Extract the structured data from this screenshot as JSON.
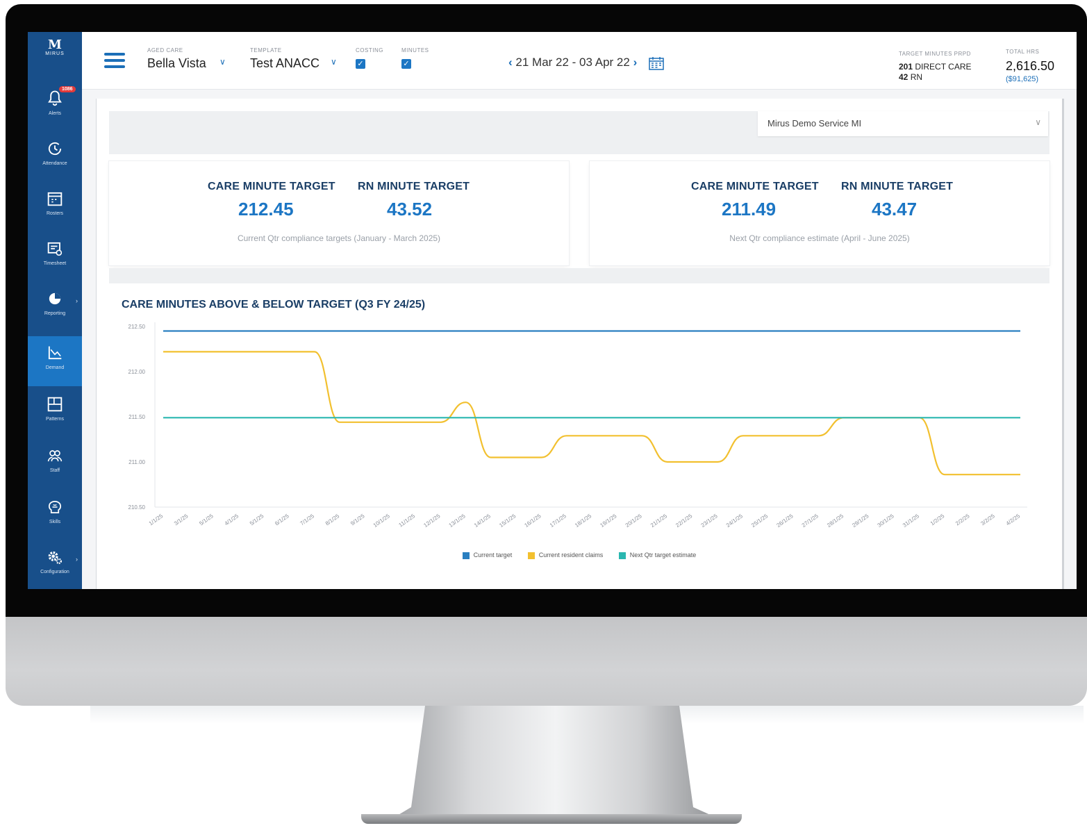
{
  "app": {
    "logo_text": "MIRUS",
    "alerts_badge": "1086"
  },
  "nav": [
    {
      "label": "Alerts",
      "icon": "bell-icon"
    },
    {
      "label": "Attendance",
      "icon": "clock-icon"
    },
    {
      "label": "Rosters",
      "icon": "calendar-grid-icon"
    },
    {
      "label": "Timesheet",
      "icon": "timesheet-icon"
    },
    {
      "label": "Reporting",
      "icon": "pie-chart-icon"
    },
    {
      "label": "Demand",
      "icon": "line-chart-icon",
      "active": true
    },
    {
      "label": "Patterns",
      "icon": "layout-icon"
    },
    {
      "label": "Staff",
      "icon": "staff-icon"
    },
    {
      "label": "Skills",
      "icon": "brain-icon"
    },
    {
      "label": "Configuration",
      "icon": "gear-icon"
    }
  ],
  "header": {
    "aged_care_caption": "AGED CARE",
    "aged_care_value": "Bella Vista",
    "template_caption": "TEMPLATE",
    "template_value": "Test ANACC",
    "costing_caption": "COSTING",
    "minutes_caption": "MINUTES",
    "costing_checked": true,
    "minutes_checked": true,
    "date_range": "21 Mar 22 - 03 Apr 22",
    "target_caption": "TARGET MINUTES PRPD",
    "target_direct_value": "201",
    "target_direct_label": "DIRECT CARE",
    "target_rn_value": "42",
    "target_rn_label": "RN",
    "total_hrs_caption": "TOTAL HRS",
    "total_hrs_value": "2,616.50",
    "total_cost": "($91,625)"
  },
  "service_select": {
    "value": "Mirus Demo Service MI"
  },
  "cards": [
    {
      "care_heading": "CARE MINUTE TARGET",
      "care_value": "212.45",
      "rn_heading": "RN MINUTE TARGET",
      "rn_value": "43.52",
      "note": "Current Qtr compliance targets (January - March 2025)"
    },
    {
      "care_heading": "CARE MINUTE TARGET",
      "care_value": "211.49",
      "rn_heading": "RN MINUTE TARGET",
      "rn_value": "43.47",
      "note": "Next Qtr compliance estimate (April - June 2025)"
    }
  ],
  "chart_title": "CARE MINUTES ABOVE & BELOW TARGET (Q3 FY 24/25)",
  "chart_data": {
    "type": "line",
    "title": "CARE MINUTES ABOVE & BELOW TARGET (Q3 FY 24/25)",
    "xlabel": "",
    "ylabel": "",
    "ylim": [
      210.5,
      212.5
    ],
    "y_ticks": [
      "210.50",
      "211.00",
      "211.50",
      "212.00",
      "212.50"
    ],
    "categories": [
      "1/1/25",
      "3/1/25",
      "5/1/25",
      "4/1/25",
      "5/1/25",
      "6/1/25",
      "7/1/25",
      "8/1/25",
      "9/1/25",
      "10/1/25",
      "11/1/25",
      "12/1/25",
      "13/1/25",
      "14/1/25",
      "15/1/25",
      "16/1/25",
      "17/1/25",
      "18/1/25",
      "19/1/25",
      "20/1/25",
      "21/1/25",
      "22/1/25",
      "23/1/25",
      "24/1/25",
      "25/1/25",
      "26/1/25",
      "27/1/25",
      "28/1/25",
      "29/1/25",
      "30/1/25",
      "31/1/25",
      "1/2/25",
      "2/2/25",
      "3/2/25",
      "4/2/25"
    ],
    "grid": false,
    "legend_position": "bottom-center",
    "series": [
      {
        "name": "Current target",
        "color": "#2a7fc0",
        "values": [
          212.45,
          212.45,
          212.45,
          212.45,
          212.45,
          212.45,
          212.45,
          212.45,
          212.45,
          212.45,
          212.45,
          212.45,
          212.45,
          212.45,
          212.45,
          212.45,
          212.45,
          212.45,
          212.45,
          212.45,
          212.45,
          212.45,
          212.45,
          212.45,
          212.45,
          212.45,
          212.45,
          212.45,
          212.45,
          212.45,
          212.45,
          212.45,
          212.45,
          212.45,
          212.45
        ]
      },
      {
        "name": "Current resident claims",
        "color": "#f2c02f",
        "values": [
          212.22,
          212.22,
          212.22,
          212.22,
          212.22,
          212.22,
          212.22,
          211.44,
          211.44,
          211.44,
          211.44,
          211.44,
          211.66,
          211.05,
          211.05,
          211.05,
          211.29,
          211.29,
          211.29,
          211.29,
          211.0,
          211.0,
          211.0,
          211.29,
          211.29,
          211.29,
          211.29,
          211.49,
          211.49,
          211.49,
          211.49,
          210.86,
          210.86,
          210.86,
          210.86
        ]
      },
      {
        "name": "Next Qtr target estimate",
        "color": "#2ab7b0",
        "values": [
          211.49,
          211.49,
          211.49,
          211.49,
          211.49,
          211.49,
          211.49,
          211.49,
          211.49,
          211.49,
          211.49,
          211.49,
          211.49,
          211.49,
          211.49,
          211.49,
          211.49,
          211.49,
          211.49,
          211.49,
          211.49,
          211.49,
          211.49,
          211.49,
          211.49,
          211.49,
          211.49,
          211.49,
          211.49,
          211.49,
          211.49,
          211.49,
          211.49,
          211.49,
          211.49
        ]
      }
    ]
  }
}
